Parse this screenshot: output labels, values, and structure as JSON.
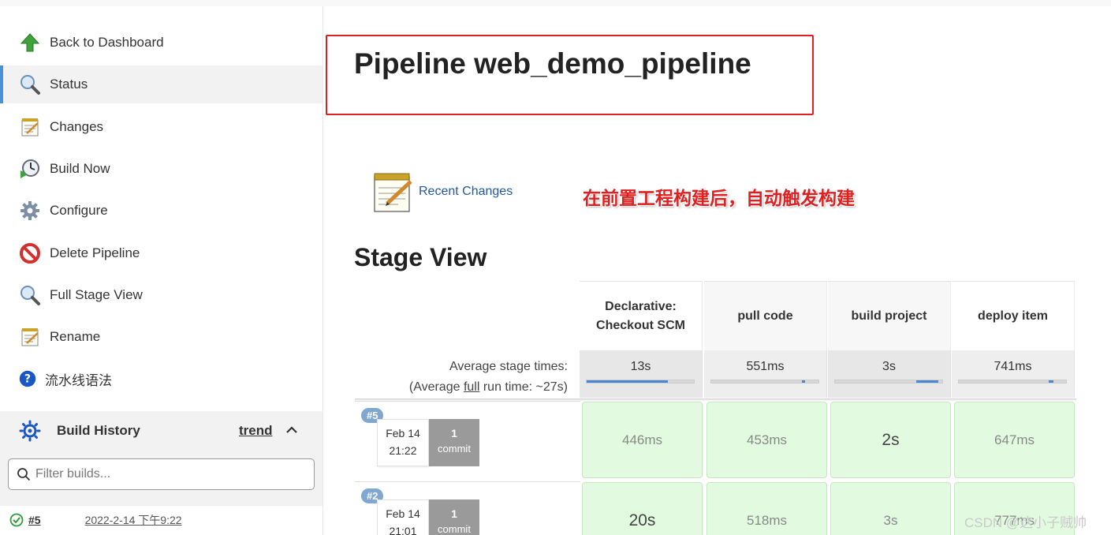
{
  "sidebar": {
    "items": [
      {
        "label": "Back to Dashboard",
        "icon": "up-arrow-icon"
      },
      {
        "label": "Status",
        "icon": "magnifier-icon"
      },
      {
        "label": "Changes",
        "icon": "notepad-icon"
      },
      {
        "label": "Build Now",
        "icon": "clock-play-icon"
      },
      {
        "label": "Configure",
        "icon": "gear-icon"
      },
      {
        "label": "Delete Pipeline",
        "icon": "no-entry-icon"
      },
      {
        "label": "Full Stage View",
        "icon": "magnifier-icon"
      },
      {
        "label": "Rename",
        "icon": "notepad-icon"
      },
      {
        "label": "流水线语法",
        "icon": "help-icon"
      }
    ]
  },
  "build_history": {
    "title": "Build History",
    "trend": "trend",
    "filter_placeholder": "Filter builds...",
    "builds": [
      {
        "number": "#5",
        "date": "2022-2-14 下午9:22"
      }
    ]
  },
  "main": {
    "title": "Pipeline web_demo_pipeline",
    "recent_changes": "Recent Changes",
    "annotation": "在前置工程构建后，自动触发构建",
    "stage_view_title": "Stage View",
    "avg_stage_label": "Average stage times:",
    "avg_run_prefix": "(Average ",
    "avg_run_full": "full",
    "avg_run_suffix": " run time: ~27s)"
  },
  "stage_view": {
    "stages": [
      {
        "name": "Declarative: Checkout SCM",
        "avg": "13s",
        "avg_fill": 0.76
      },
      {
        "name": "pull code",
        "avg": "551ms",
        "avg_fill": 0.03
      },
      {
        "name": "build project",
        "avg": "3s",
        "avg_fill": 0.2
      },
      {
        "name": "deploy item",
        "avg": "741ms",
        "avg_fill": 0.04
      }
    ],
    "runs": [
      {
        "badge": "#5",
        "date": "Feb 14",
        "time": "21:22",
        "commit_count": "1",
        "commit_label": "commit",
        "durations": [
          "446ms",
          "453ms",
          "2s",
          "647ms"
        ]
      },
      {
        "badge": "#2",
        "date": "Feb 14",
        "time": "21:01",
        "commit_count": "1",
        "commit_label": "commit",
        "durations": [
          "20s",
          "518ms",
          "3s",
          "777ms"
        ]
      }
    ]
  },
  "watermark": "CSDN @这小子贼帅",
  "colors": {
    "accent": "#4a90d9",
    "annotation": "#e02020",
    "success_cell": "#e2fbe0",
    "link": "#2059a8"
  }
}
